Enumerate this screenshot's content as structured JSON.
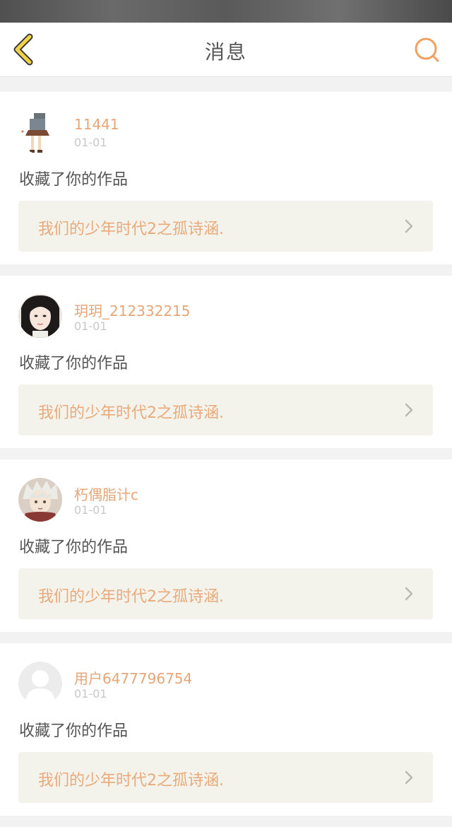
{
  "header": {
    "title": "消息",
    "back_icon": "chevron-left-icon",
    "search_icon": "search-icon",
    "accent_color": "#f0a060"
  },
  "messages": [
    {
      "username": "11441",
      "date": "01-01",
      "action": "收藏了你的作品",
      "work_title": "我们的少年时代2之孤诗涵.",
      "avatar": "avatar-girl-figure"
    },
    {
      "username": "玥玥_212332215",
      "date": "01-01",
      "action": "收藏了你的作品",
      "work_title": "我们的少年时代2之孤诗涵.",
      "avatar": "avatar-woman-portrait"
    },
    {
      "username": "朽偶脂计c",
      "date": "01-01",
      "action": "收藏了你的作品",
      "work_title": "我们的少年时代2之孤诗涵.",
      "avatar": "avatar-anime-boy"
    },
    {
      "username": "用户6477796754",
      "date": "01-01",
      "action": "收藏了你的作品",
      "work_title": "我们的少年时代2之孤诗涵.",
      "avatar": "avatar-default-user"
    }
  ]
}
